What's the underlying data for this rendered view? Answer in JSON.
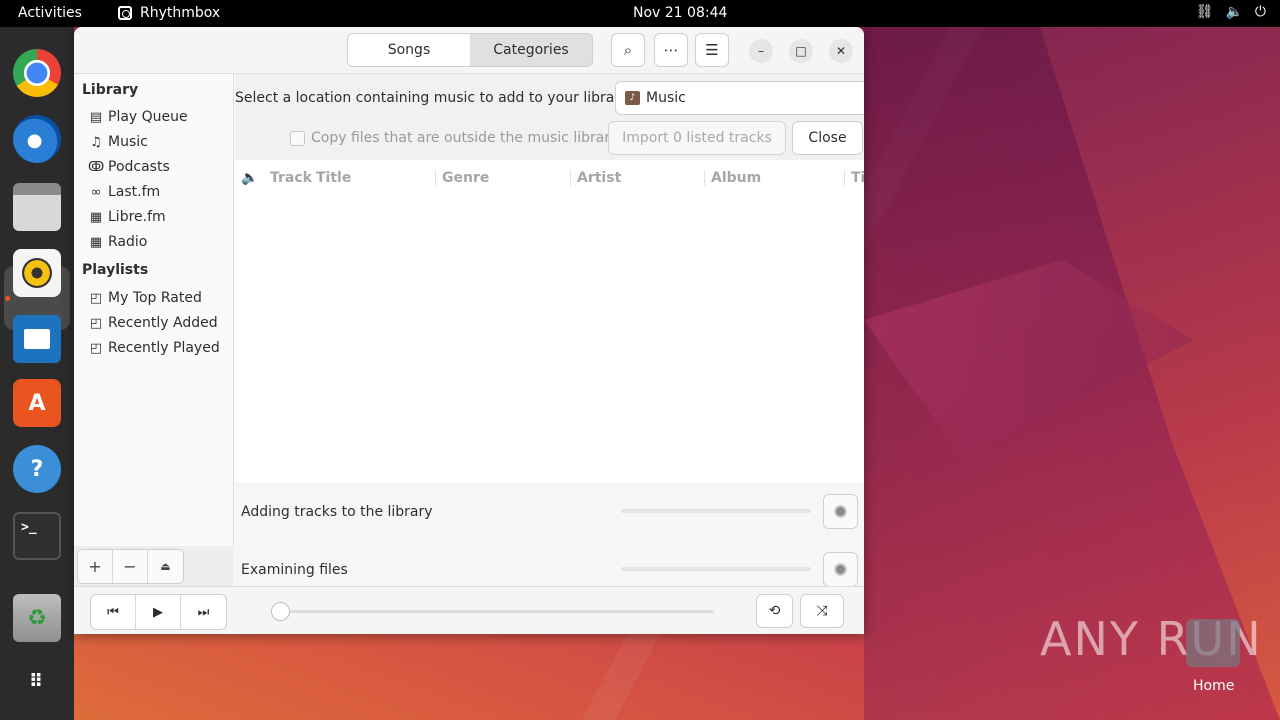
{
  "topbar": {
    "activities": "Activities",
    "app_name": "Rhythmbox",
    "clock": "Nov 21  08:44",
    "tray": [
      "network-icon",
      "volume-icon",
      "power-icon"
    ]
  },
  "dock": {
    "apps": [
      "chrome",
      "thunderbird",
      "files",
      "rhythmbox",
      "libreoffice-writer",
      "app-center",
      "help",
      "terminal",
      "trash",
      "show-apps"
    ]
  },
  "headerbar": {
    "tabs": [
      {
        "label": "Songs"
      },
      {
        "label": "Categories"
      }
    ],
    "active_tab": "Categories"
  },
  "sidebar": {
    "library_heading": "Library",
    "library_items": [
      {
        "label": "Play Queue",
        "icon": "queue-icon"
      },
      {
        "label": "Music",
        "icon": "music-note-icon"
      },
      {
        "label": "Podcasts",
        "icon": "rss-icon"
      },
      {
        "label": "Last.fm",
        "icon": "lastfm-icon"
      },
      {
        "label": "Libre.fm",
        "icon": "radio-icon"
      },
      {
        "label": "Radio",
        "icon": "radio-icon"
      }
    ],
    "playlists_heading": "Playlists",
    "playlist_items": [
      {
        "label": "My Top Rated",
        "icon": "smart-playlist-icon"
      },
      {
        "label": "Recently Added",
        "icon": "smart-playlist-icon"
      },
      {
        "label": "Recently Played",
        "icon": "smart-playlist-icon"
      }
    ]
  },
  "import": {
    "prompt": "Select a location containing music to add to your library:",
    "location": "Music",
    "copy_label": "Copy files that are outside the music library",
    "import_button": "Import 0 listed tracks",
    "close_button": "Close"
  },
  "columns": [
    "Track",
    "Title",
    "Genre",
    "Artist",
    "Album",
    "Ti"
  ],
  "progress": {
    "adding": "Adding tracks to the library",
    "examining": "Examining files"
  },
  "watermark": "ANY RUN",
  "desktop": {
    "home_label": "Home"
  }
}
